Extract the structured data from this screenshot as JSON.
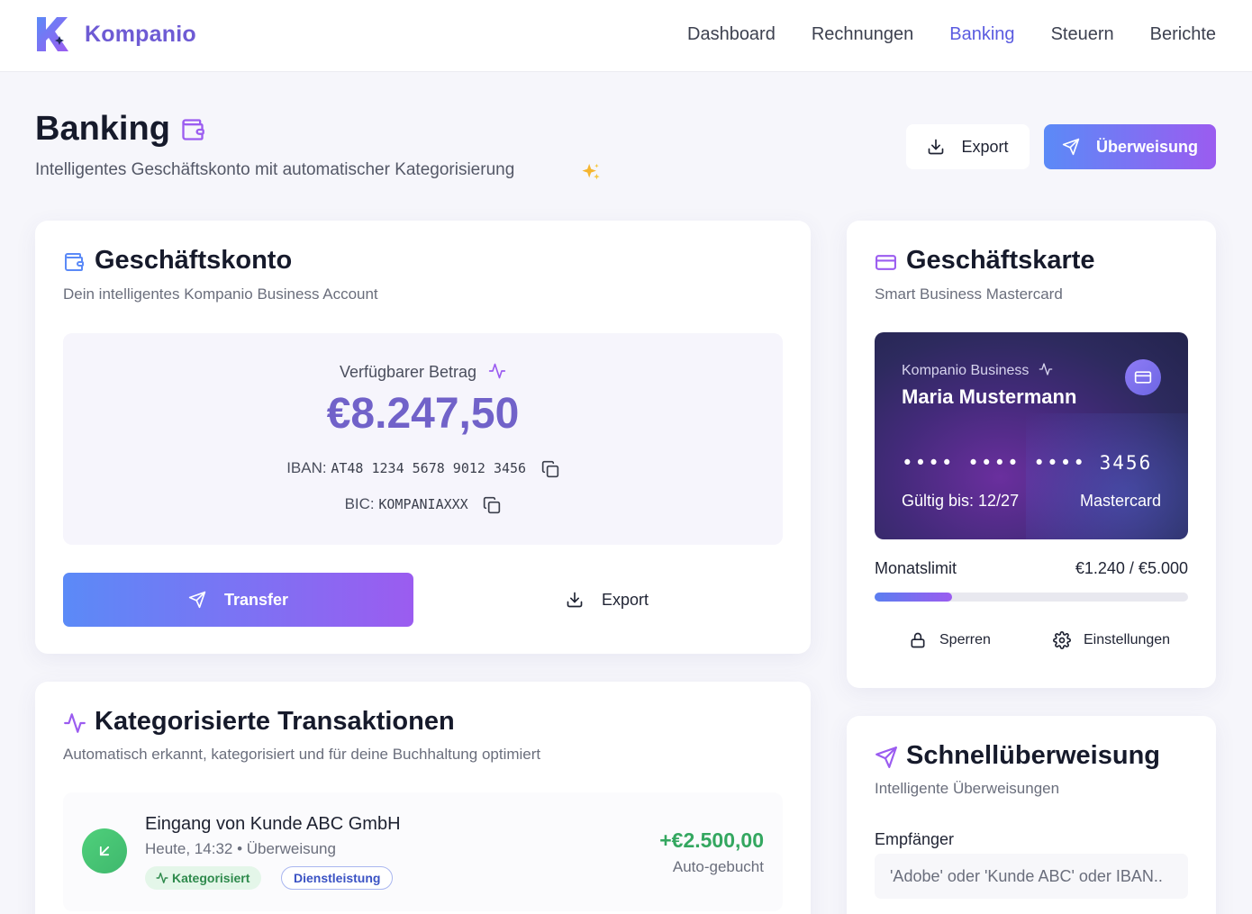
{
  "app": {
    "brand": "Kompanio"
  },
  "nav": {
    "items": [
      {
        "label": "Dashboard"
      },
      {
        "label": "Rechnungen"
      },
      {
        "label": "Banking",
        "active": true
      },
      {
        "label": "Steuern"
      },
      {
        "label": "Berichte"
      }
    ]
  },
  "page": {
    "title": "Banking",
    "subtitle": "Intelligentes Geschäftskonto mit automatischer Kategorisierung",
    "export_label": "Export",
    "transfer_label": "Überweisung"
  },
  "account": {
    "title": "Geschäftskonto",
    "subtitle": "Dein intelligentes Kompanio Business Account",
    "balance_label": "Verfügbarer Betrag",
    "balance": "€8.247,50",
    "iban_label": "IBAN:",
    "iban": "AT48 1234 5678 9012 3456",
    "bic_label": "BIC:",
    "bic": "KOMPANIAXXX",
    "transfer_button": "Transfer",
    "export_button": "Export"
  },
  "transactions": {
    "title": "Kategorisierte Transaktionen",
    "subtitle": "Automatisch erkannt, kategorisiert und für deine Buchhaltung optimiert",
    "items": [
      {
        "name": "Eingang von Kunde ABC GmbH",
        "meta": "Heute, 14:32 • Überweisung",
        "tag_status": "Kategorisiert",
        "tag_category": "Dienstleistung",
        "amount": "+€2.500,00",
        "status": "Auto-gebucht"
      }
    ]
  },
  "card": {
    "title": "Geschäftskarte",
    "subtitle": "Smart Business Mastercard",
    "brand": "Kompanio Business",
    "holder": "Maria Mustermann",
    "number": "•••• •••• •••• 3456",
    "expiry": "Gültig bis: 12/27",
    "network": "Mastercard",
    "limit_label": "Monatslimit",
    "limit_value": "€1.240 / €5.000",
    "limit_fraction": 0.248,
    "lock_label": "Sperren",
    "settings_label": "Einstellungen"
  },
  "quick_transfer": {
    "title": "Schnellüberweisung",
    "subtitle": "Intelligente Überweisungen",
    "recipient_label": "Empfänger",
    "recipient_placeholder": "'Adobe' oder 'Kunde ABC' oder IBAN.."
  },
  "colors": {
    "accent": "#5a5be0",
    "brand": "#6e5bd4",
    "positive": "#34a760"
  }
}
